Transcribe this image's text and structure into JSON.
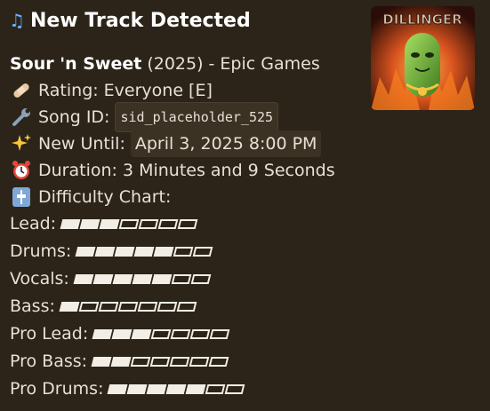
{
  "title": "New Track Detected",
  "track": {
    "name": "Sour 'n Sweet",
    "meta": "(2025) - Epic Games"
  },
  "rating": {
    "label": "Rating:",
    "value": "Everyone [E]"
  },
  "song_id": {
    "label": "Song ID:",
    "value": "sid_placeholder_525"
  },
  "new_until": {
    "label": "New Until:",
    "value": "April 3, 2025 8:00 PM"
  },
  "duration": {
    "label": "Duration:",
    "value": "3 Minutes and 9 Seconds"
  },
  "difficulty_header": "Difficulty Chart:",
  "difficulties": [
    {
      "label": "Lead:",
      "level": 3,
      "max": 7
    },
    {
      "label": "Drums:",
      "level": 5,
      "max": 7
    },
    {
      "label": "Vocals:",
      "level": 5,
      "max": 7
    },
    {
      "label": "Bass:",
      "level": 1,
      "max": 7
    },
    {
      "label": "Pro Lead:",
      "level": 3,
      "max": 7
    },
    {
      "label": "Pro Bass:",
      "level": 2,
      "max": 7
    },
    {
      "label": "Pro Drums:",
      "level": 5,
      "max": 7
    }
  ],
  "cover_text": "DILLINGER",
  "colors": {
    "background": "#2c2418",
    "text": "#e6e0d6",
    "accent_note": "#6ab0ff"
  },
  "icons": [
    "music-note-icon",
    "bandage-icon",
    "wrench-icon",
    "sparkles-icon",
    "alarm-clock-icon",
    "level-slider-icon"
  ]
}
